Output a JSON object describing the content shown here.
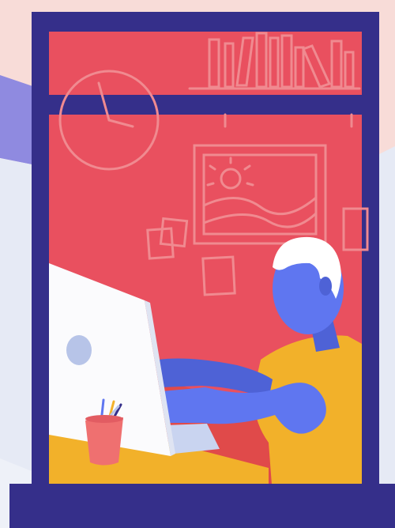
{
  "scene": {
    "colors": {
      "backdrop_top": "#f8dcd8",
      "backdrop_light": "#eef1f8",
      "backdrop_purple": "#8f8ae0",
      "window_frame": "#352f8a",
      "wall": "#e9505f",
      "wall_line": "#f08a90",
      "desk": "#f2b12a",
      "desk_shadow": "#e04a4a",
      "person_skin": "#5f76f0",
      "person_skin_dark": "#4e62d6",
      "person_hair": "#ffffff",
      "shirt": "#f2b12a",
      "monitor": "#fbfbfd",
      "monitor_logo": "#b7c4e8",
      "keyboard": "#c9d4f0",
      "cup": "#ef7070"
    },
    "icons": [
      "wall-clock-icon",
      "bookshelf-icon",
      "landscape-picture-icon",
      "sticky-note-icon",
      "pencil-cup-icon",
      "computer-monitor-icon"
    ]
  }
}
